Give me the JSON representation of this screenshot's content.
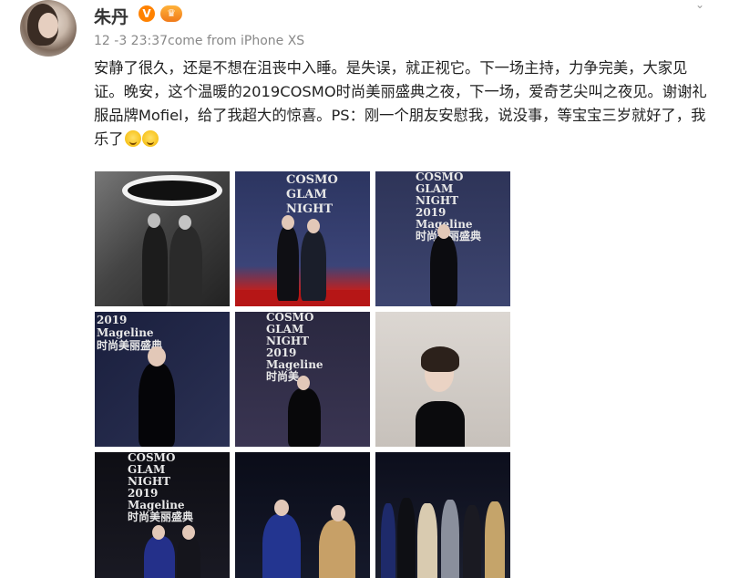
{
  "user": {
    "name": "朱丹",
    "verified_badge": "V",
    "vip_badge": "♛"
  },
  "post": {
    "meta": "12 -3 23:37come from iPhone XS",
    "text": "安静了很久，还是不想在沮丧中入睡。是失误，就正视它。下一场主持，力争完美，大家见证。晚安，这个温暖的2019COSMO时尚美丽盛典之夜，下一场，爱奇艺尖叫之夜见。谢谢礼服品牌Mofiel，给了我超大的惊喜。PS：刚一个朋友安慰我，说没事，等宝宝三岁就好了，我乐了"
  },
  "photos": {
    "p2_text": "COSMO\nGLAM\nNIGHT",
    "p3_text": "COSMO\nGLAM\nNIGHT\n2019\nMageline\n时尚美丽盛典",
    "p4_text": "2019\nMageline\n时尚美丽盛典",
    "p5_text": "COSMO\nGLAM\nNIGHT\n2019\nMageline\n时尚美",
    "p7_text": "COSMO\nGLAM\nNIGHT\n2019\nMageline\n时尚美丽盛典"
  },
  "icons": {
    "more": "chevron-down-icon",
    "emoji": "laughing-crying-emoji-icon"
  },
  "colors": {
    "verified": "#ff8200",
    "meta": "#888888",
    "text": "#222222"
  }
}
